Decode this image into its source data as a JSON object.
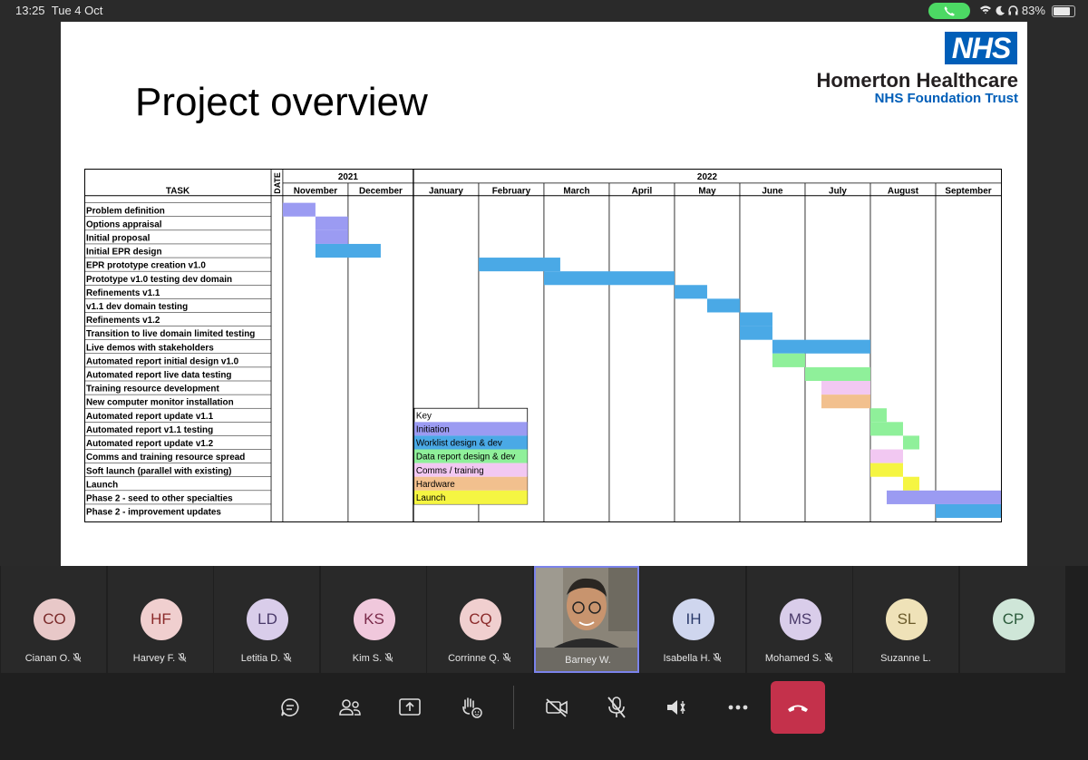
{
  "status_bar": {
    "time": "13:25",
    "date": "Tue 4 Oct",
    "battery": "83%"
  },
  "slide": {
    "title": "Project overview",
    "logo_text": "NHS",
    "org_name": "Homerton Healthcare",
    "org_subtitle": "NHS Foundation Trust"
  },
  "gantt": {
    "task_header": "TASK",
    "date_header": "DATE",
    "years": [
      "2021",
      "2022"
    ],
    "months": [
      "November",
      "December",
      "January",
      "February",
      "March",
      "April",
      "May",
      "June",
      "July",
      "August",
      "September"
    ],
    "tasks": [
      "Problem definition",
      "Options appraisal",
      "Initial proposal",
      "Initial EPR design",
      "EPR prototype creation v1.0",
      "Prototype v1.0 testing dev domain",
      "Refinements v1.1",
      "v1.1 dev domain testing",
      "Refinements v1.2",
      "Transition to live domain limited testing",
      "Live demos with stakeholders",
      "Automated report initial design v1.0",
      "Automated report live data testing",
      "Training resource development",
      "New computer monitor installation",
      "Automated report update v1.1",
      "Automated report v1.1 testing",
      "Automated report update v1.2",
      "Comms and training resource spread",
      "Soft launch (parallel with existing)",
      "Launch",
      "Phase 2 - seed to other specialties",
      "Phase 2 - improvement updates"
    ],
    "key_title": "Key",
    "key": [
      {
        "label": "Initiation",
        "color": "#9b9bf2"
      },
      {
        "label": "Worklist design & dev",
        "color": "#4aa9e6"
      },
      {
        "label": "Data report design & dev",
        "color": "#8ff09a"
      },
      {
        "label": "Comms / training",
        "color": "#f2c8f2"
      },
      {
        "label": "Hardware",
        "color": "#f2c08e"
      },
      {
        "label": "Launch",
        "color": "#f5f542"
      }
    ],
    "bars": [
      {
        "task": 0,
        "start": 0,
        "end": 0.5,
        "cat": 0
      },
      {
        "task": 1,
        "start": 0.5,
        "end": 1,
        "cat": 0
      },
      {
        "task": 2,
        "start": 0.5,
        "end": 1,
        "cat": 0
      },
      {
        "task": 3,
        "start": 0.5,
        "end": 1.5,
        "cat": 1
      },
      {
        "task": 4,
        "start": 3,
        "end": 4.25,
        "cat": 1
      },
      {
        "task": 5,
        "start": 4,
        "end": 6,
        "cat": 1
      },
      {
        "task": 6,
        "start": 6,
        "end": 6.5,
        "cat": 1
      },
      {
        "task": 7,
        "start": 6.5,
        "end": 7,
        "cat": 1
      },
      {
        "task": 8,
        "start": 7,
        "end": 7.5,
        "cat": 1
      },
      {
        "task": 9,
        "start": 7,
        "end": 7.5,
        "cat": 1
      },
      {
        "task": 10,
        "start": 7.5,
        "end": 9,
        "cat": 1
      },
      {
        "task": 11,
        "start": 7.5,
        "end": 8,
        "cat": 2
      },
      {
        "task": 12,
        "start": 8,
        "end": 9,
        "cat": 2
      },
      {
        "task": 13,
        "start": 8.25,
        "end": 9,
        "cat": 3
      },
      {
        "task": 14,
        "start": 8.25,
        "end": 9,
        "cat": 4
      },
      {
        "task": 15,
        "start": 9,
        "end": 9.25,
        "cat": 2
      },
      {
        "task": 16,
        "start": 9,
        "end": 9.5,
        "cat": 2
      },
      {
        "task": 17,
        "start": 9.5,
        "end": 9.75,
        "cat": 2
      },
      {
        "task": 18,
        "start": 9,
        "end": 9.5,
        "cat": 3
      },
      {
        "task": 19,
        "start": 9,
        "end": 9.5,
        "cat": 5
      },
      {
        "task": 20,
        "start": 9.5,
        "end": 9.75,
        "cat": 5
      },
      {
        "task": 21,
        "start": 9.25,
        "end": 11,
        "cat": 0
      },
      {
        "task": 22,
        "start": 10,
        "end": 11,
        "cat": 1
      }
    ]
  },
  "participants": [
    {
      "initials": "CO",
      "name": "Cianan O.",
      "muted": true,
      "bg": "#e8c8c8",
      "fg": "#7a2a2a"
    },
    {
      "initials": "HF",
      "name": "Harvey F.",
      "muted": true,
      "bg": "#f0cfcf",
      "fg": "#8a2a2a"
    },
    {
      "initials": "LD",
      "name": "Letitia D.",
      "muted": true,
      "bg": "#d9cdea",
      "fg": "#4a3a6a"
    },
    {
      "initials": "KS",
      "name": "Kim S.",
      "muted": true,
      "bg": "#f0c8dc",
      "fg": "#7a2a4a"
    },
    {
      "initials": "CQ",
      "name": "Corrinne Q.",
      "muted": true,
      "bg": "#f0cfcf",
      "fg": "#8a2a2a"
    },
    {
      "initials": "",
      "name": "Barney W.",
      "muted": false,
      "bg": "",
      "fg": ""
    },
    {
      "initials": "IH",
      "name": "Isabella H.",
      "muted": true,
      "bg": "#cfd6ee",
      "fg": "#2a3a6a"
    },
    {
      "initials": "MS",
      "name": "Mohamed S.",
      "muted": true,
      "bg": "#d9cdea",
      "fg": "#4a3a6a"
    },
    {
      "initials": "SL",
      "name": "Suzanne L.",
      "muted": false,
      "bg": "#efe2b8",
      "fg": "#6a5a2a"
    },
    {
      "initials": "CP",
      "name": "",
      "muted": false,
      "bg": "#cfe6d8",
      "fg": "#2a5a3a"
    }
  ],
  "controls": {
    "chat": "chat-icon",
    "people": "people-icon",
    "share": "share-icon",
    "react": "raise-hand-icon",
    "camera": "camera-off-icon",
    "mic": "mic-off-icon",
    "speaker": "speaker-icon",
    "more": "more-icon",
    "leave": "hang-up-icon"
  }
}
